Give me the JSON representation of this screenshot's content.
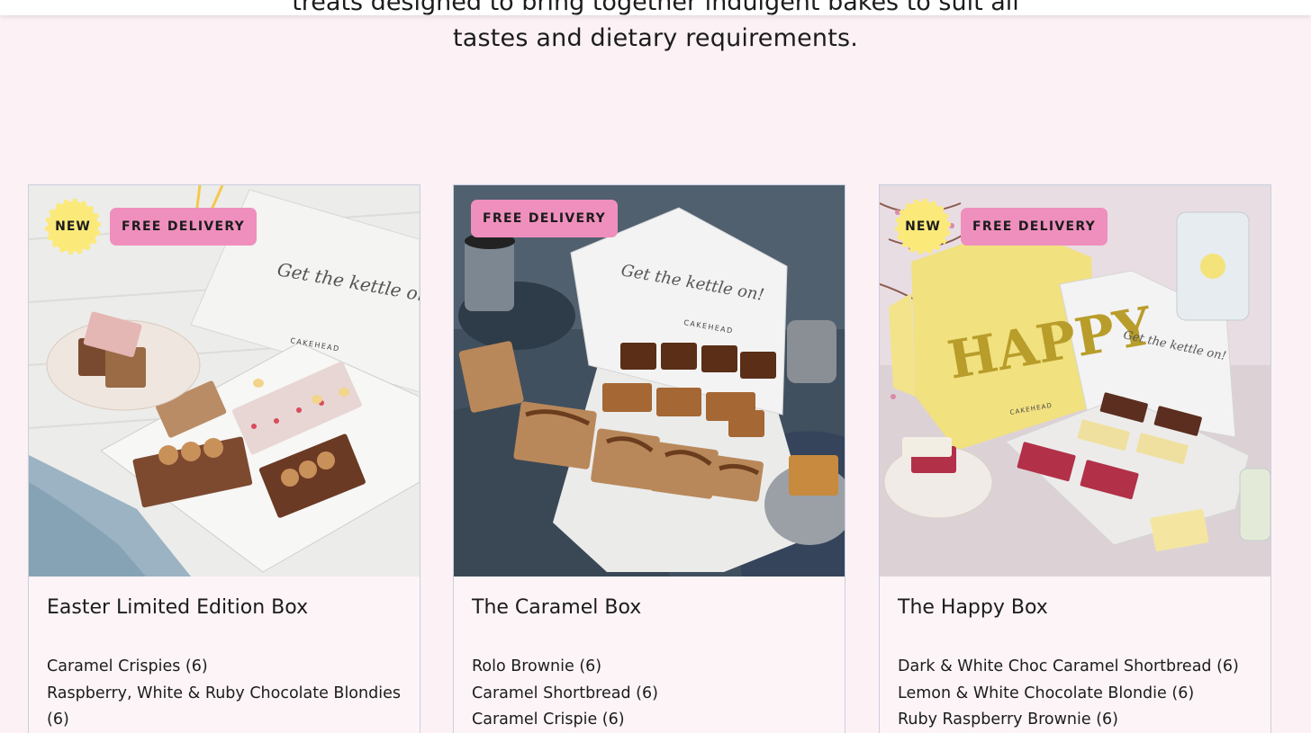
{
  "header": {
    "cut_text": "treats designed to bring together indulgent bakes to suit all",
    "intro_line": "tastes and dietary requirements."
  },
  "products": [
    {
      "title": "Easter Limited Edition Box",
      "badges": {
        "new": "NEW",
        "delivery": "FREE DELIVERY"
      },
      "items": [
        "Caramel Crispies (6)",
        "Raspberry, White & Ruby Chocolate Blondies (6)"
      ],
      "photo_lid_text": "Get the kettle on!",
      "photo_brand": "CAKEHEAD"
    },
    {
      "title": "The Caramel Box",
      "badges": {
        "delivery": "FREE DELIVERY"
      },
      "items": [
        "Rolo Brownie (6)",
        "Caramel Shortbread (6)",
        "Caramel Crispie (6)"
      ],
      "photo_lid_text": "Get the kettle on!",
      "photo_brand": "CAKEHEAD"
    },
    {
      "title": "The Happy Box",
      "badges": {
        "new": "NEW",
        "delivery": "FREE DELIVERY"
      },
      "items": [
        "Dark & White Choc Caramel Shortbread (6)",
        "Lemon & White Chocolate Blondie (6)",
        "Ruby Raspberry Brownie (6)"
      ],
      "photo_lid_text": "Get the kettle on!",
      "photo_brand": "CAKEHEAD",
      "photo_box_text": "HAPPY"
    }
  ],
  "colors": {
    "page_bg": "#fcf1f4",
    "new_badge": "#fbe97a",
    "delivery_badge": "#ef8fbd",
    "card_border": "#c9cfe0"
  }
}
